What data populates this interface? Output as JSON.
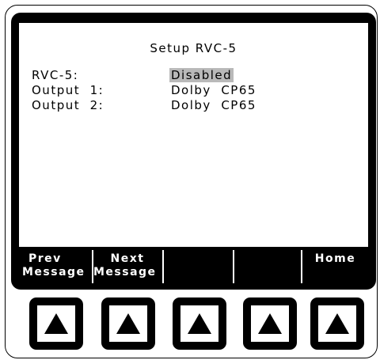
{
  "screen": {
    "title": "Setup RVC-5",
    "rows": [
      {
        "label": "RVC-5:",
        "value": "Disabled",
        "selected": true
      },
      {
        "label": "Output  1:",
        "value": "Dolby  CP65",
        "selected": false
      },
      {
        "label": "Output  2:",
        "value": "Dolby  CP65",
        "selected": false
      }
    ]
  },
  "softkeys": [
    {
      "line1": "Prev",
      "line2": "Message"
    },
    {
      "line1": "Next",
      "line2": "Message"
    },
    {
      "line1": "",
      "line2": ""
    },
    {
      "line1": "",
      "line2": ""
    },
    {
      "line1": "Home",
      "line2": ""
    }
  ],
  "hardware_buttons": [
    {
      "icon": "up-arrow-icon"
    },
    {
      "icon": "up-arrow-icon"
    },
    {
      "icon": "up-arrow-icon"
    },
    {
      "icon": "up-arrow-icon"
    },
    {
      "icon": "up-arrow-icon"
    }
  ],
  "colors": {
    "bezel": "#000000",
    "screen_background": "#ffffff",
    "selection_highlight": "#b9b9b9",
    "softkey_text": "#ffffff"
  }
}
